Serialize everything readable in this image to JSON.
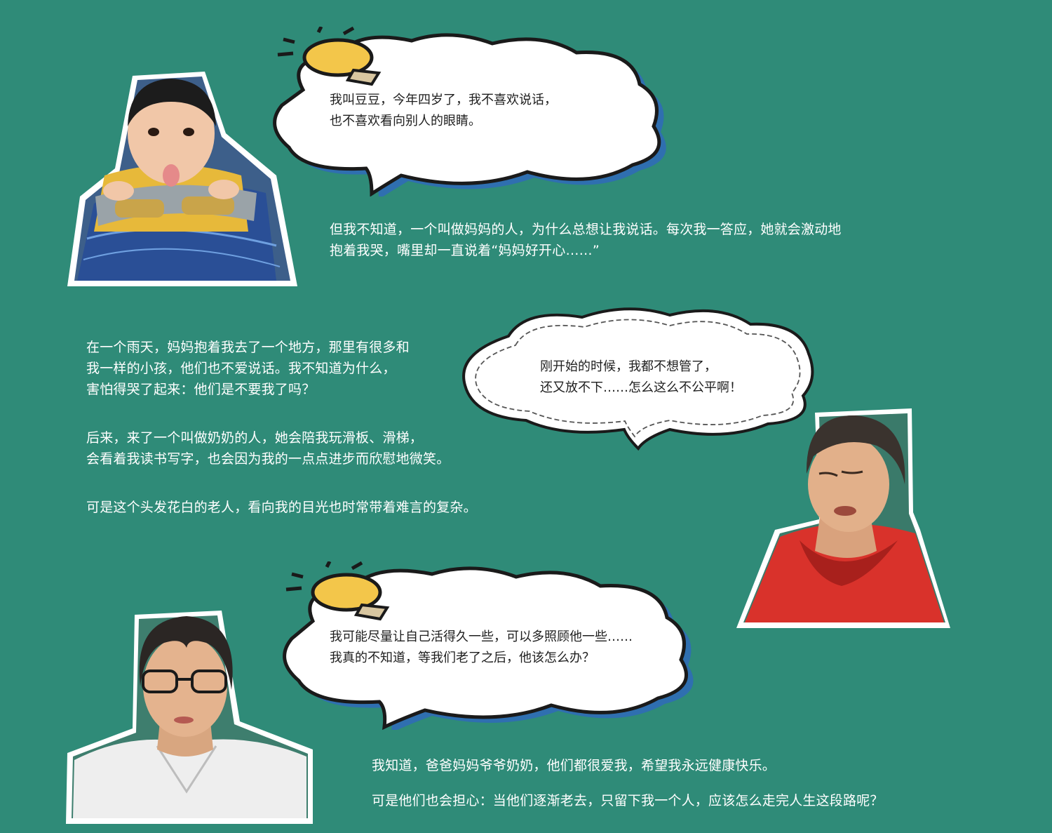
{
  "palette": {
    "background": "#2f8b78",
    "bubble_fill": "#ffffff",
    "bubble_outline": "#1a1a1a",
    "bubble_shadow": "#2f6fb0",
    "bulb": "#f3c64a"
  },
  "bubbles": [
    {
      "name": "doudou-intro",
      "text": "我叫豆豆，今年四岁了，我不喜欢说话，\n也不喜欢看向别人的眼睛。"
    },
    {
      "name": "grandma-quote",
      "text": "刚开始的时候，我都不想管了，\n还又放不下……怎么这么不公平啊！"
    },
    {
      "name": "mother-quote",
      "text": "我可能尽量让自己活得久一些，可以多照顾他一些……\n我真的不知道，等我们老了之后，他该怎么办？"
    }
  ],
  "paragraphs": {
    "p1": "但我不知道，一个叫做妈妈的人，为什么总想让我说话。每次我一答应，她就会激动地\n抱着我哭，嘴里却一直说着“妈妈好开心……”",
    "p2": "在一个雨天，妈妈抱着我去了一个地方，那里有很多和\n我一样的小孩，他们也不爱说话。我不知道为什么，\n害怕得哭了起来：他们是不要我了吗？",
    "p3": "后来，来了一个叫做奶奶的人，她会陪我玩滑板、滑梯，\n会看着我读书写字，也会因为我的一点点进步而欣慰地微笑。",
    "p4": "可是这个头发花白的老人，看向我的目光也时常带着难言的复杂。",
    "p5": "我知道，爸爸妈妈爷爷奶奶，他们都很爱我，希望我永远健康快乐。",
    "p6": "可是他们也会担心：当他们逐渐老去，只留下我一个人，应该怎么走完人生这段路呢？"
  },
  "icons": [
    "lightbulb-icon",
    "lightbulb-icon"
  ],
  "portraits": [
    "child-portrait",
    "grandmother-portrait",
    "mother-portrait"
  ]
}
